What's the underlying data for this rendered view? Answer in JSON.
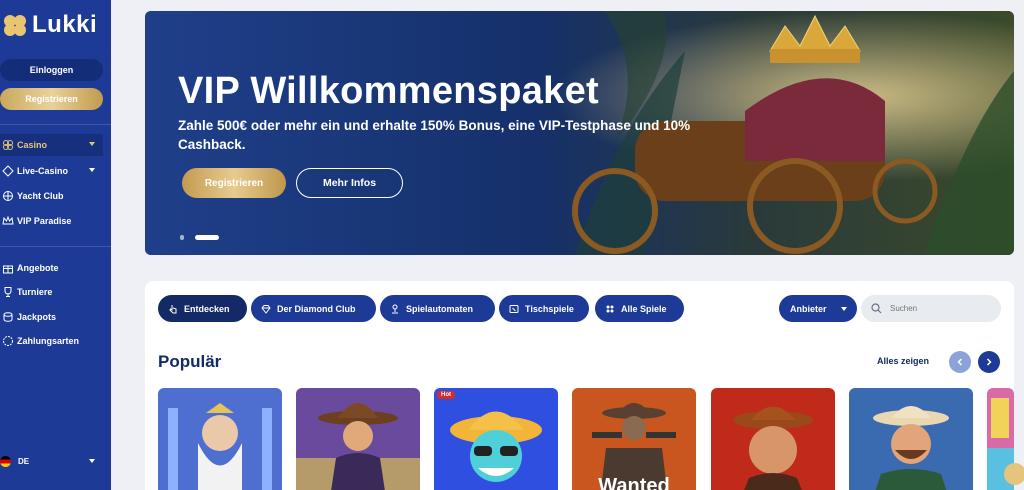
{
  "brand": {
    "name": "Lukki"
  },
  "auth": {
    "login_label": "Einloggen",
    "register_label": "Registrieren"
  },
  "nav": {
    "primary": [
      {
        "label": "Casino",
        "icon": "clover-icon",
        "active": true,
        "has_chevron": true
      },
      {
        "label": "Live-Casino",
        "icon": "diamond-icon",
        "active": false,
        "has_chevron": true
      },
      {
        "label": "Yacht Club",
        "icon": "wheel-icon",
        "active": false,
        "has_chevron": false
      },
      {
        "label": "VIP Paradise",
        "icon": "crown-icon",
        "active": false,
        "has_chevron": false
      }
    ],
    "secondary": [
      {
        "label": "Angebote",
        "icon": "gift-icon"
      },
      {
        "label": "Turniere",
        "icon": "trophy-icon"
      },
      {
        "label": "Jackpots",
        "icon": "coins-icon"
      },
      {
        "label": "Zahlungsarten",
        "icon": "wallet-icon"
      }
    ],
    "language": "DE"
  },
  "banner": {
    "title": "VIP Willkommenspaket",
    "subtitle_prefix": "Zahle ",
    "subtitle_amount": "500€",
    "subtitle_rest": " oder mehr ein und erhalte 150% Bonus, eine VIP-Testphase und 10% Cashback.",
    "register_label": "Registrieren",
    "info_label": "Mehr Infos"
  },
  "filters": {
    "tabs": [
      {
        "label": "Entdecken",
        "icon": "pointer-icon",
        "active": true
      },
      {
        "label": "Der Diamond Club",
        "icon": "diamond-icon",
        "active": false
      },
      {
        "label": "Spielautomaten",
        "icon": "joystick-icon",
        "active": false
      },
      {
        "label": "Tischspiele",
        "icon": "cards-icon",
        "active": false
      },
      {
        "label": "Alle Spiele",
        "icon": "grid-icon",
        "active": false
      }
    ],
    "provider_label": "Anbieter",
    "search_placeholder": "Suchen"
  },
  "popular": {
    "title": "Populär",
    "show_all": "Alles zeigen",
    "games": [
      {
        "badge": "",
        "overlay_text": ""
      },
      {
        "badge": "",
        "overlay_text": ""
      },
      {
        "badge": "Hot",
        "overlay_text": ""
      },
      {
        "badge": "",
        "overlay_text": "Wanted"
      },
      {
        "badge": "",
        "overlay_text": ""
      },
      {
        "badge": "",
        "overlay_text": ""
      }
    ]
  },
  "colors": {
    "brand_blue": "#1d3b96",
    "navy": "#132a66",
    "gold": "#e3c47d",
    "background": "#eef0f5"
  }
}
